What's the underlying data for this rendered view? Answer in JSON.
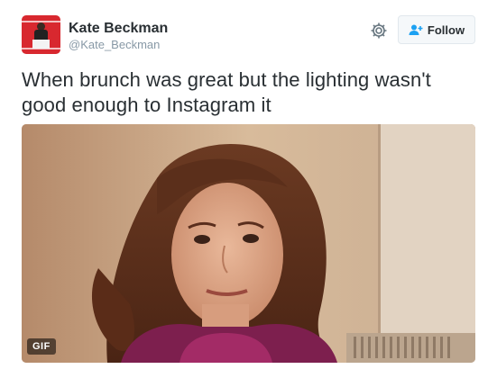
{
  "user": {
    "display_name": "Kate Beckman",
    "handle": "@Kate_Beckman"
  },
  "actions": {
    "follow_label": "Follow",
    "settings_icon": "gear-icon",
    "follow_icon": "add-user-icon"
  },
  "tweet": {
    "text": "When brunch was great but the lighting wasn't good enough to Instagram it"
  },
  "media": {
    "badge": "GIF"
  },
  "colors": {
    "avatar_bg": "#d8282f",
    "follow_icon": "#1da1f2",
    "text": "#292f33",
    "secondary_text": "#8899a6",
    "button_border": "#e1e8ed"
  }
}
